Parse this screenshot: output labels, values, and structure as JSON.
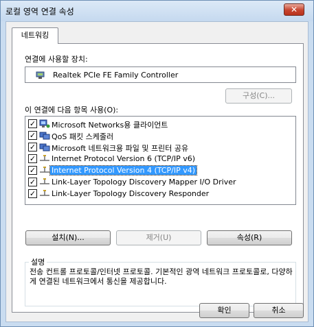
{
  "window": {
    "title": "로컬 영역 연결 속성",
    "close_glyph": "✕"
  },
  "tabs": [
    {
      "label": "네트워킹"
    }
  ],
  "device": {
    "label": "연결에 사용할 장치:",
    "name": "Realtek PCIe FE Family Controller",
    "configure_button": "구성(C)..."
  },
  "items": {
    "label": "이 연결에 다음 항목 사용(O):",
    "list": [
      {
        "text": "Microsoft Networks용 클라이언트",
        "checked": true,
        "icon": "network-client-icon"
      },
      {
        "text": "QoS 패킷 스케줄러",
        "checked": true,
        "icon": "network-service-icon"
      },
      {
        "text": "Microsoft 네트워크용 파일 및 프린터 공유",
        "checked": true,
        "icon": "network-service-icon"
      },
      {
        "text": "Internet Protocol Version 6 (TCP/IP v6)",
        "checked": true,
        "icon": "protocol-icon"
      },
      {
        "text": "Internet Protocol Version 4 (TCP/IP v4)",
        "checked": true,
        "icon": "protocol-icon",
        "selected": true
      },
      {
        "text": "Link-Layer Topology Discovery Mapper I/O Driver",
        "checked": true,
        "icon": "protocol-icon"
      },
      {
        "text": "Link-Layer Topology Discovery Responder",
        "checked": true,
        "icon": "protocol-icon"
      }
    ]
  },
  "buttons": {
    "install": "설치(N)...",
    "uninstall": "제거(U)",
    "properties": "속성(R)",
    "ok": "확인",
    "cancel": "취소"
  },
  "description": {
    "title": "설명",
    "text": "전송 컨트롤 프로토콜/인터넷 프로토콜. 기본적인 광역 네트워크 프로토콜로, 다양하게 연결된 네트워크에서 통신을 제공합니다."
  },
  "colors": {
    "selection": "#3399ff",
    "titlebar": "#c5d9ef",
    "close": "#c7442e"
  }
}
